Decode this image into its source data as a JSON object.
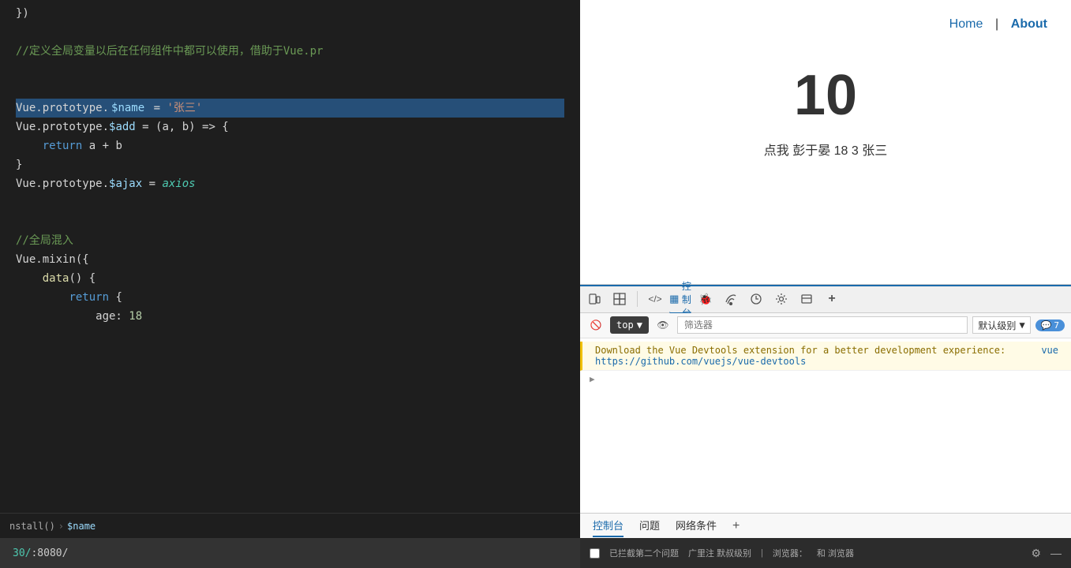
{
  "code": {
    "lines": [
      {
        "content": "})",
        "parts": [
          {
            "text": "})",
            "class": "token-punctuation"
          }
        ]
      },
      {
        "content": "",
        "parts": []
      },
      {
        "content": "//定义全局变量以后在任何组件中都可以使用，借助于Vue.pr",
        "parts": [
          {
            "text": "//定义全局变量以后在任何组件中都可以使用，借助于Vue.pr",
            "class": "token-comment"
          }
        ]
      },
      {
        "content": "",
        "parts": []
      },
      {
        "content": "",
        "parts": []
      },
      {
        "content": "Vue.prototype.$name = '张三'",
        "highlighted": true,
        "parts": [
          {
            "text": "Vue",
            "class": "token-punctuation"
          },
          {
            "text": ".prototype.",
            "class": "token-punctuation"
          },
          {
            "text": "$name",
            "class": "token-highlight-bg token-variable"
          },
          {
            "text": " = ",
            "class": "token-punctuation"
          },
          {
            "text": "'张三'",
            "class": "token-string"
          }
        ]
      },
      {
        "content": "Vue.prototype.$add = (a, b) => {",
        "parts": [
          {
            "text": "Vue.prototype.",
            "class": "token-punctuation"
          },
          {
            "text": "$add",
            "class": "token-variable"
          },
          {
            "text": " = (a, b) => {",
            "class": "token-punctuation"
          }
        ]
      },
      {
        "content": "    return a + b",
        "parts": [
          {
            "text": "    ",
            "class": ""
          },
          {
            "text": "return",
            "class": "token-keyword"
          },
          {
            "text": " a + b",
            "class": "token-punctuation"
          }
        ]
      },
      {
        "content": "}",
        "parts": [
          {
            "text": "}",
            "class": "token-punctuation"
          }
        ]
      },
      {
        "content": "Vue.prototype.$ajax = axios",
        "parts": [
          {
            "text": "Vue.prototype.",
            "class": "token-punctuation"
          },
          {
            "text": "$ajax",
            "class": "token-variable"
          },
          {
            "text": " = ",
            "class": "token-punctuation"
          },
          {
            "text": "axios",
            "class": "token-italic"
          }
        ]
      },
      {
        "content": "",
        "parts": []
      },
      {
        "content": "",
        "parts": []
      },
      {
        "content": "//全局混入",
        "parts": [
          {
            "text": "//全局混入",
            "class": "token-comment"
          }
        ]
      },
      {
        "content": "Vue.mixin({",
        "parts": [
          {
            "text": "Vue.mixin({",
            "class": "token-punctuation"
          }
        ]
      },
      {
        "content": "    data() {",
        "parts": [
          {
            "text": "    ",
            "class": ""
          },
          {
            "text": "data",
            "class": "token-orange"
          },
          {
            "text": "() {",
            "class": "token-punctuation"
          }
        ]
      },
      {
        "content": "        return {",
        "parts": [
          {
            "text": "        ",
            "class": ""
          },
          {
            "text": "return",
            "class": "token-keyword"
          },
          {
            "text": " {",
            "class": "token-punctuation"
          }
        ]
      },
      {
        "content": "            age: 18",
        "parts": [
          {
            "text": "            age: ",
            "class": "token-punctuation"
          },
          {
            "text": "18",
            "class": "token-number"
          }
        ]
      }
    ]
  },
  "breadcrumb": {
    "left": "nstall()",
    "separator": "›",
    "right": "$name"
  },
  "preview": {
    "nav": {
      "home": "Home",
      "separator": "|",
      "about": "About"
    },
    "number": "10",
    "text": "点我 彭于晏 18 3 张三"
  },
  "devtools": {
    "tabs": [
      {
        "label": "",
        "icon": "📱",
        "active": false
      },
      {
        "label": "",
        "icon": "⬜",
        "active": false
      },
      {
        "label": "</> ",
        "active": false
      },
      {
        "label": "控制台",
        "active": true
      },
      {
        "label": "🐞",
        "active": false
      },
      {
        "label": "📶",
        "active": false
      },
      {
        "label": "⌖",
        "active": false
      },
      {
        "label": "⚙",
        "active": false
      },
      {
        "label": "▭",
        "active": false
      },
      {
        "label": "+",
        "active": false
      }
    ],
    "console": {
      "filter_placeholder": "筛选器",
      "level_label": "默认级别",
      "badge_count": "7",
      "context_label": "top",
      "messages": [
        {
          "type": "warning",
          "text": "Download the Vue Devtools extension for a better development experience:",
          "link": "vue",
          "link_text": "https://github.com/vuejs/vue-devtools"
        }
      ]
    }
  },
  "bottom_tabs": [
    {
      "label": "控制台",
      "active": true
    },
    {
      "label": "问题"
    },
    {
      "label": "网络条件"
    },
    {
      "label": "+"
    }
  ],
  "status_bar": {
    "checkbox_label": "已拦截第二个问题",
    "item1": "广里注 默叔级别",
    "item2": "浏览器：",
    "item3": "和 浏览器",
    "gear": "⚙",
    "close": "—"
  },
  "addr_bar": {
    "text": "30/",
    "full": ":8080/"
  }
}
